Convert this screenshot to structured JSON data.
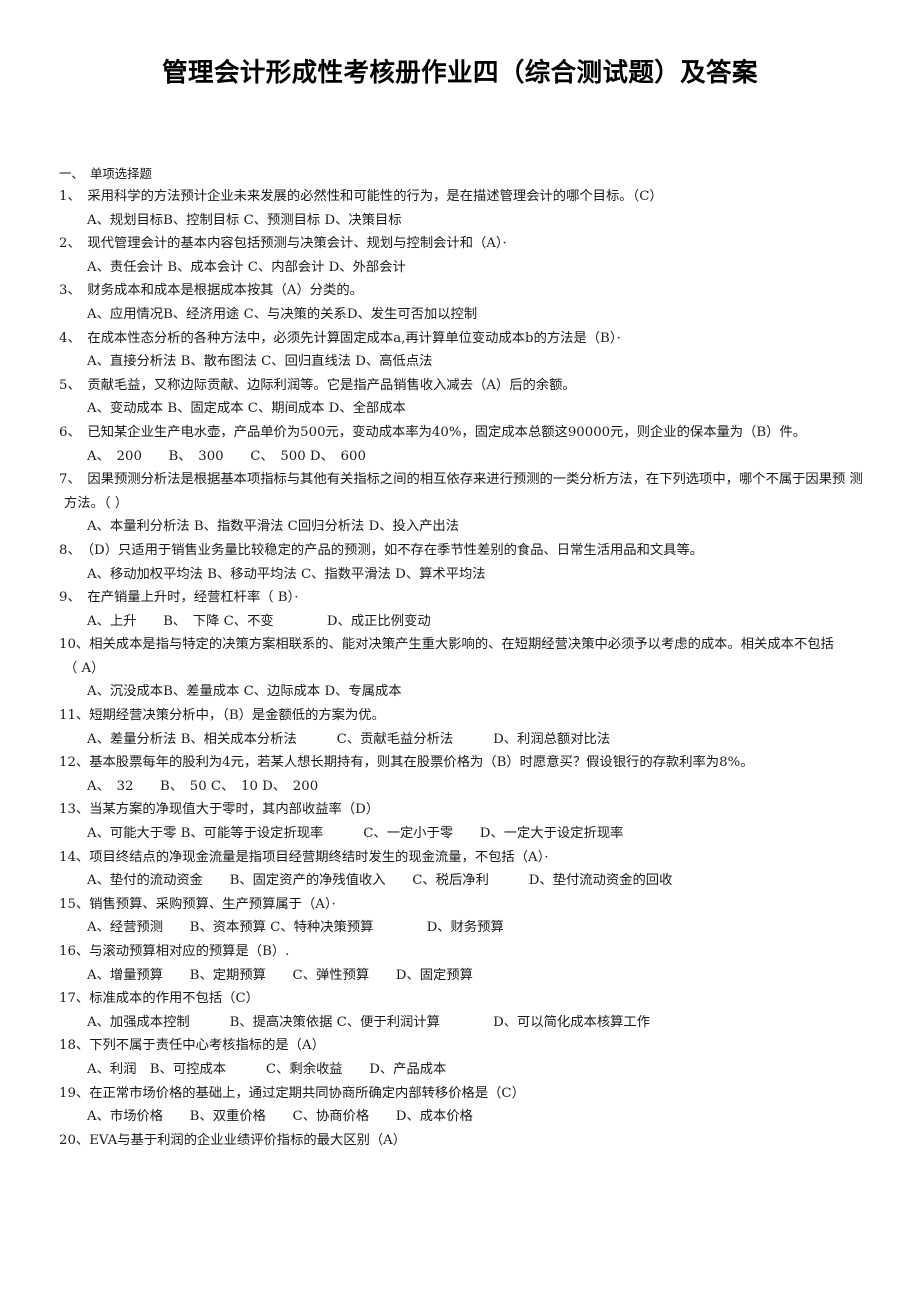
{
  "document": {
    "title": "管理会计形成性考核册作业四（综合测试题）及答案",
    "section_heading": "一、　单项选择题"
  },
  "lines": [
    {
      "kind": "section",
      "text": "一、　单项选择题"
    },
    {
      "kind": "q",
      "text": "1、　采用科学的方法预计企业未来发展的必然性和可能性的行为，是在描述管理会计的哪个目标。（C）"
    },
    {
      "kind": "opt",
      "text": "A、规划目标B、控制目标 C、预测目标 D、决策目标"
    },
    {
      "kind": "q",
      "text": "2、　现代管理会计的基本内容包括预测与决策会计、规划与控制会计和（A）·"
    },
    {
      "kind": "opt",
      "text": "A、责任会计 B、成本会计 C、内部会计 D、外部会计"
    },
    {
      "kind": "q",
      "text": "3、　财务成本和成本是根据成本按其（A）分类的。"
    },
    {
      "kind": "opt",
      "text": "A、应用情况B、经济用途 C、与决策的关系D、发生可否加以控制"
    },
    {
      "kind": "q",
      "text": "4、　在成本性态分析的各种方法中，必须先计算固定成本a,再计算单位变动成本b的方法是（B）·"
    },
    {
      "kind": "opt",
      "text": "A、直接分析法 B、散布图法 C、回归直线法 D、高低点法"
    },
    {
      "kind": "q",
      "text": "5、　贡献毛益，又称边际贡献、边际利润等。它是指产品销售收入减去（A）后的余额。"
    },
    {
      "kind": "opt",
      "text": "A、变动成本 B、固定成本 C、期间成本 D、全部成本"
    },
    {
      "kind": "q",
      "text": "6、　已知某企业生产电水壶，产品单价为500元，变动成本率为40%，固定成本总额这90000元，则企业的保本量为（B）件。"
    },
    {
      "kind": "opt",
      "text": "A、　200　　B、　300　　C、　500 D、　600"
    },
    {
      "kind": "q",
      "text": "7、　因果预测分析法是根据基本项指标与其他有关指标之间的相互依存来进行预测的一类分析方法，在下列选项中，哪个不属于因果预 测"
    },
    {
      "kind": "cont",
      "text": "方法。（ ）"
    },
    {
      "kind": "opt",
      "text": "A、本量利分析法 B、指数平滑法 C回归分析法 D、投入产出法"
    },
    {
      "kind": "q",
      "text": "8、　（D）只适用于销售业务量比较稳定的产品的预测，如不存在季节性差别的食品、日常生活用品和文具等。"
    },
    {
      "kind": "opt",
      "text": "A、移动加权平均法 B、移动平均法 C、指数平滑法 D、算术平均法"
    },
    {
      "kind": "q",
      "text": "9、　在产销量上升时，经营杠杆率（ B）·"
    },
    {
      "kind": "opt",
      "text": "A、上升　　B、　下降 C、不变　　　　D、成正比例变动"
    },
    {
      "kind": "q",
      "text": "10、相关成本是指与特定的决策方案相联系的、能对决策产生重大影响的、在短期经营决策中必须予以考虑的成本。相关成本不包括"
    },
    {
      "kind": "cont",
      "text": "（ A）"
    },
    {
      "kind": "opt",
      "text": "A、沉没成本B、差量成本 C、边际成本 D、专属成本"
    },
    {
      "kind": "q",
      "text": "11、短期经营决策分析中，（B）是金额低的方案为优。"
    },
    {
      "kind": "opt",
      "text": "A、差量分析法 B、相关成本分析法　　　C、贡献毛益分析法　　　D、利润总额对比法"
    },
    {
      "kind": "q",
      "text": "12、基本股票每年的股利为4元，若某人想长期持有，则其在股票价格为（B）时愿意买？假设银行的存款利率为8%。"
    },
    {
      "kind": "opt",
      "text": "A、　32　　B、　50 C、　10 D、　200"
    },
    {
      "kind": "q",
      "text": "13、当某方案的净现值大于零时，其内部收益率（D）"
    },
    {
      "kind": "opt",
      "text": "A、可能大于零 B、可能等于设定折现率　　　C、一定小于零　　D、一定大于设定折现率"
    },
    {
      "kind": "q",
      "text": "14、项目终结点的净现金流量是指项目经营期终结时发生的现金流量，不包括（A）·"
    },
    {
      "kind": "opt",
      "text": "A、垫付的流动资金　　B、固定资产的净残值收入　　C、税后净利　　　D、垫付流动资金的回收"
    },
    {
      "kind": "q",
      "text": "15、销售预算、采购预算、生产预算属于（A）·"
    },
    {
      "kind": "opt",
      "text": "A、经营预测　　B、资本预算 C、特种决策预算　　　　D、财务预算"
    },
    {
      "kind": "q",
      "text": "16、与滚动预算相对应的预算是（B）."
    },
    {
      "kind": "opt",
      "text": "A、增量预算　　B、定期预算　　C、弹性预算　　D、固定预算"
    },
    {
      "kind": "q",
      "text": "17、标准成本的作用不包括（C）"
    },
    {
      "kind": "opt",
      "text": "A、加强成本控制　　　B、提高决策依据 C、便于利润计算　　　　D、可以简化成本核算工作"
    },
    {
      "kind": "q",
      "text": "18、下列不属于责任中心考核指标的是（A）"
    },
    {
      "kind": "opt",
      "text": "A、利润　B、可控成本　　　C、剩余收益　　D、产品成本"
    },
    {
      "kind": "q",
      "text": "19、在正常市场价格的基础上，通过定期共同协商所确定内部转移价格是（C）"
    },
    {
      "kind": "opt",
      "text": "A、市场价格　　B、双重价格　　C、协商价格　　D、成本价格"
    },
    {
      "kind": "q",
      "text": "20、EVA与基于利润的企业业绩评价指标的最大区别（A）"
    }
  ],
  "colors": {
    "page_background": "#ffffff",
    "text": "#1a1a1a",
    "title": "#000000"
  }
}
